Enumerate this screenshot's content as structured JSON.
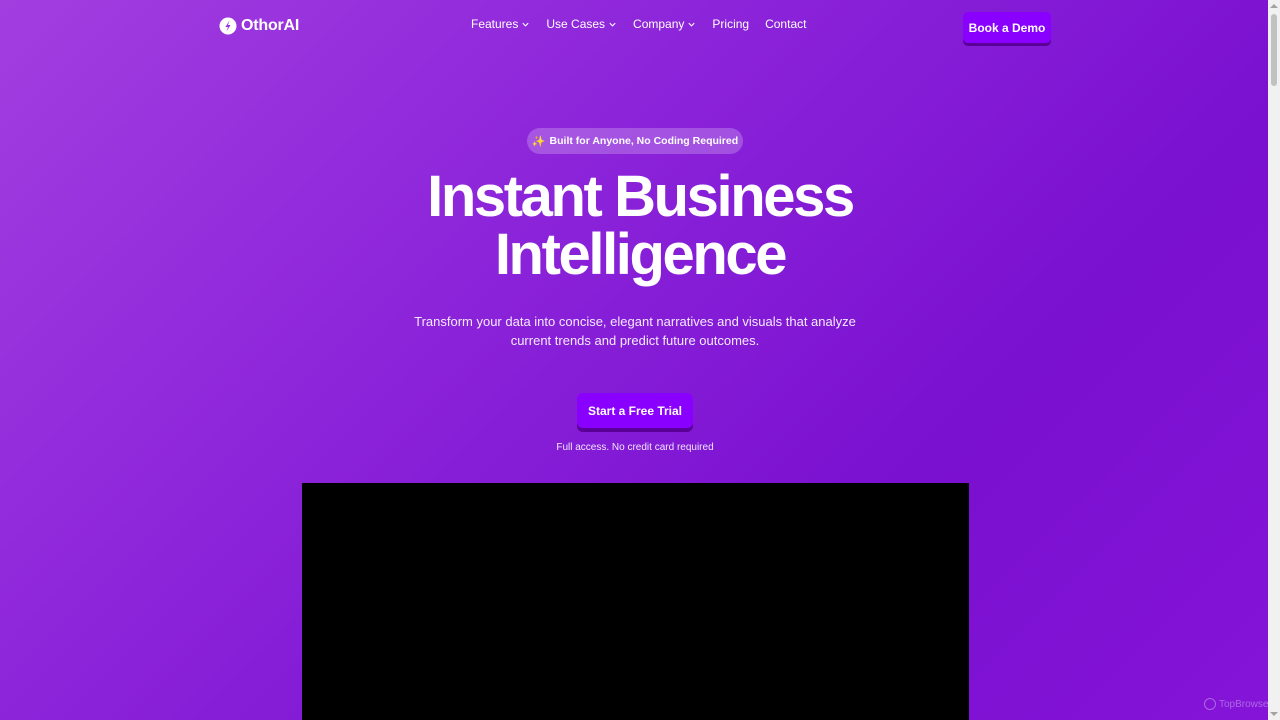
{
  "brand": {
    "name": "OthorAI"
  },
  "nav": {
    "items": [
      {
        "label": "Features",
        "dropdown": true
      },
      {
        "label": "Use Cases",
        "dropdown": true
      },
      {
        "label": "Company",
        "dropdown": true
      },
      {
        "label": "Pricing",
        "dropdown": false
      },
      {
        "label": "Contact",
        "dropdown": false
      }
    ],
    "cta_label": "Book a Demo"
  },
  "hero": {
    "badge": "Built for Anyone, No Coding Required",
    "badge_icon": "sparkles-icon",
    "title_lines": [
      "Instant Business",
      "Intelligence"
    ],
    "subtitle_lines": [
      "Transform your data into concise, elegant narratives and visuals that analyze",
      "current trends and predict future outcomes."
    ],
    "cta_label": "Start a Free Trial",
    "cta_note": "Full access. No credit card required"
  },
  "watermark": {
    "label": "TopBrowse"
  },
  "colors": {
    "accent": "#8a00ff",
    "accent_shadow": "#5a0099",
    "gradient_start": "#a23ee0",
    "gradient_end": "#7a10d0",
    "video_bg": "#000000"
  }
}
